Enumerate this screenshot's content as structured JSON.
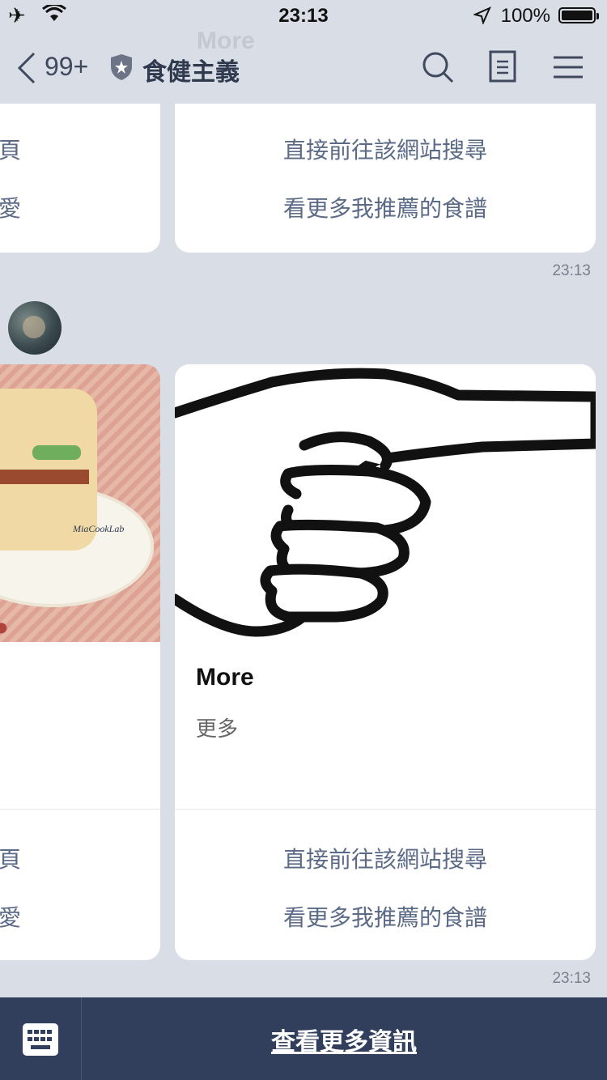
{
  "status_bar": {
    "time": "23:13",
    "battery_percent": "100%",
    "battery_level": 1.0
  },
  "header": {
    "unread_count": "99+",
    "chat_title": "食健主義",
    "ghost_title": "More"
  },
  "top_card": {
    "left_actions": [
      "頁",
      "愛"
    ],
    "actions": [
      "直接前往該網站搜尋",
      "看更多我推薦的食譜"
    ],
    "timestamp": "23:13"
  },
  "message": {
    "left_card": {
      "image_watermark": "MiaCookLab",
      "actions": [
        "頁",
        "愛"
      ]
    },
    "right_card": {
      "title": "More",
      "subtitle": "更多",
      "actions": [
        "直接前往該網站搜尋",
        "看更多我推薦的食譜"
      ]
    },
    "timestamp": "23:13"
  },
  "bottom_bar": {
    "more_info_label": "查看更多資訊"
  },
  "colors": {
    "background": "#d9dde5",
    "bottom_bar": "#313f5c",
    "action_text": "#5b6a86"
  }
}
